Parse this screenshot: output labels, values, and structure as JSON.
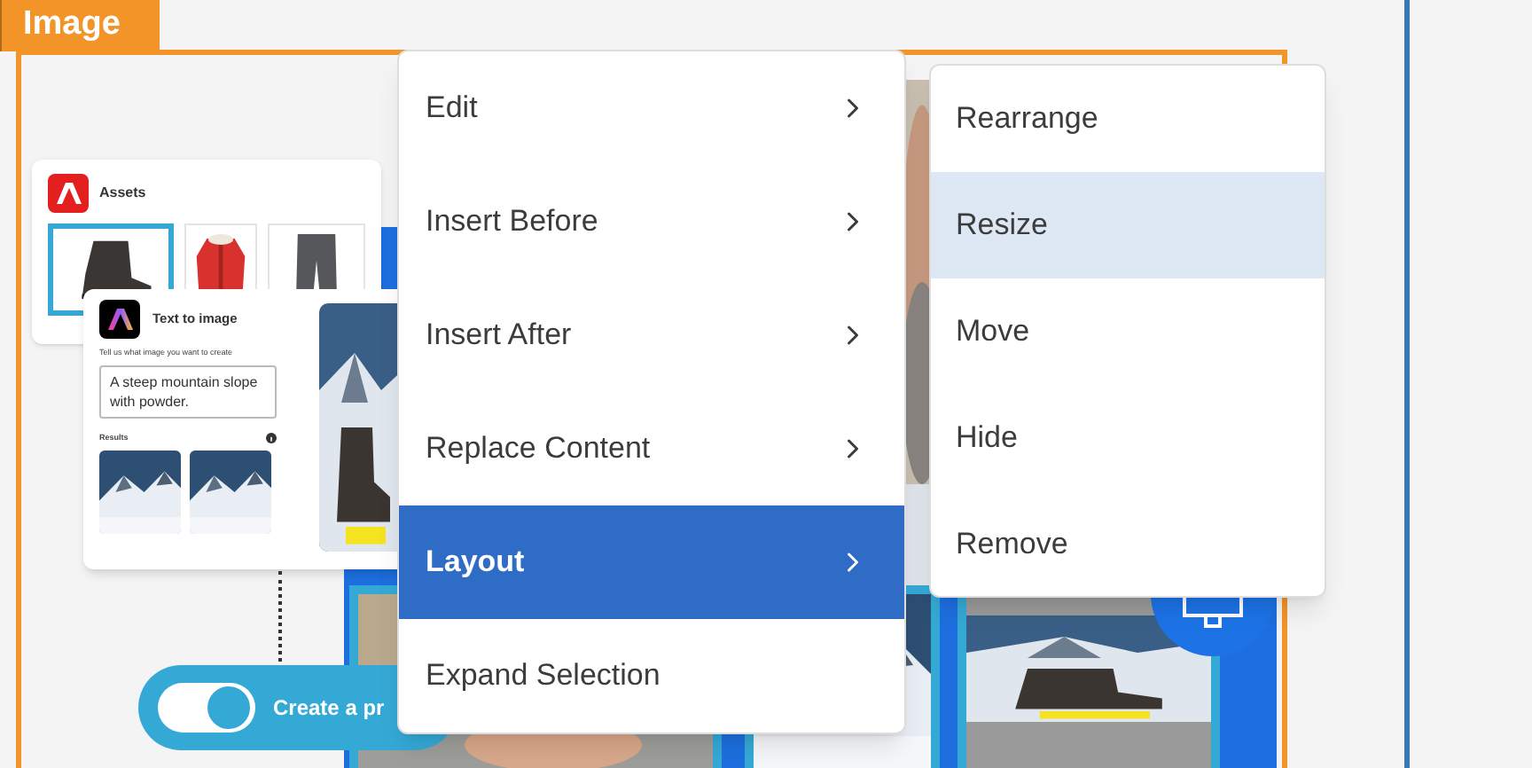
{
  "section_tab": "Image",
  "assets_card": {
    "title": "Assets"
  },
  "text_to_image_card": {
    "title": "Text to image",
    "prompt_label": "Tell us what image you want to create",
    "prompt": "A steep mountain slope with powder.",
    "results_label": "Results"
  },
  "toggle": {
    "label": "Create a pr",
    "on": true
  },
  "context_menu": {
    "items": [
      {
        "label": "Edit",
        "has_submenu": true,
        "selected": false
      },
      {
        "label": "Insert Before",
        "has_submenu": true,
        "selected": false
      },
      {
        "label": "Insert After",
        "has_submenu": true,
        "selected": false
      },
      {
        "label": "Replace Content",
        "has_submenu": true,
        "selected": false
      },
      {
        "label": "Layout",
        "has_submenu": true,
        "selected": true
      },
      {
        "label": "Expand Selection",
        "has_submenu": false,
        "selected": false
      }
    ]
  },
  "submenu": {
    "items": [
      {
        "label": "Rearrange",
        "selected": false
      },
      {
        "label": "Resize",
        "selected": true
      },
      {
        "label": "Move",
        "selected": false
      },
      {
        "label": "Hide",
        "selected": false
      },
      {
        "label": "Remove",
        "selected": false
      }
    ]
  }
}
